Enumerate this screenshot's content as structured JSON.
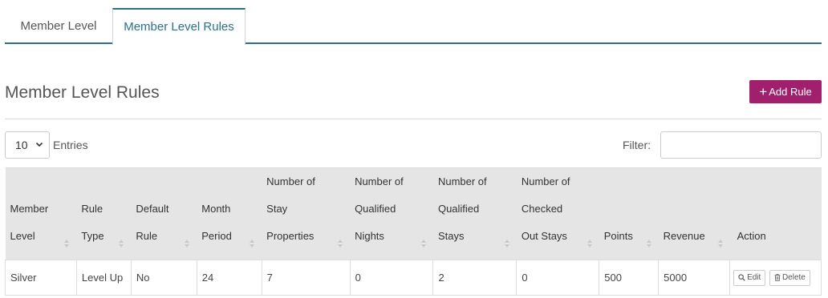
{
  "tabs": [
    {
      "label": "Member Level"
    },
    {
      "label": "Member Level Rules"
    }
  ],
  "page_title": "Member Level Rules",
  "add_button_label": "Add Rule",
  "entries": {
    "value": "10",
    "label": "Entries"
  },
  "filter": {
    "label": "Filter:",
    "value": ""
  },
  "table": {
    "columns": [
      {
        "lines": [
          "Member",
          "Level"
        ]
      },
      {
        "lines": [
          "Rule",
          "Type"
        ]
      },
      {
        "lines": [
          "Default",
          "Rule"
        ]
      },
      {
        "lines": [
          "Month",
          "Period"
        ]
      },
      {
        "lines": [
          "Number of",
          "Stay",
          "Properties"
        ]
      },
      {
        "lines": [
          "Number of",
          "Qualified",
          "Nights"
        ]
      },
      {
        "lines": [
          "Number of",
          "Qualified",
          "Stays"
        ]
      },
      {
        "lines": [
          "Number of",
          "Checked",
          "Out Stays"
        ]
      },
      {
        "lines": [
          "Points"
        ]
      },
      {
        "lines": [
          "Revenue"
        ]
      },
      {
        "lines": [
          "Action"
        ]
      }
    ],
    "rows": [
      {
        "cells": [
          "Silver",
          "Level Up",
          "No",
          "24",
          "7",
          "0",
          "2",
          "0",
          "500",
          "5000"
        ],
        "edit_label": "Edit",
        "delete_label": "Delete"
      }
    ]
  }
}
